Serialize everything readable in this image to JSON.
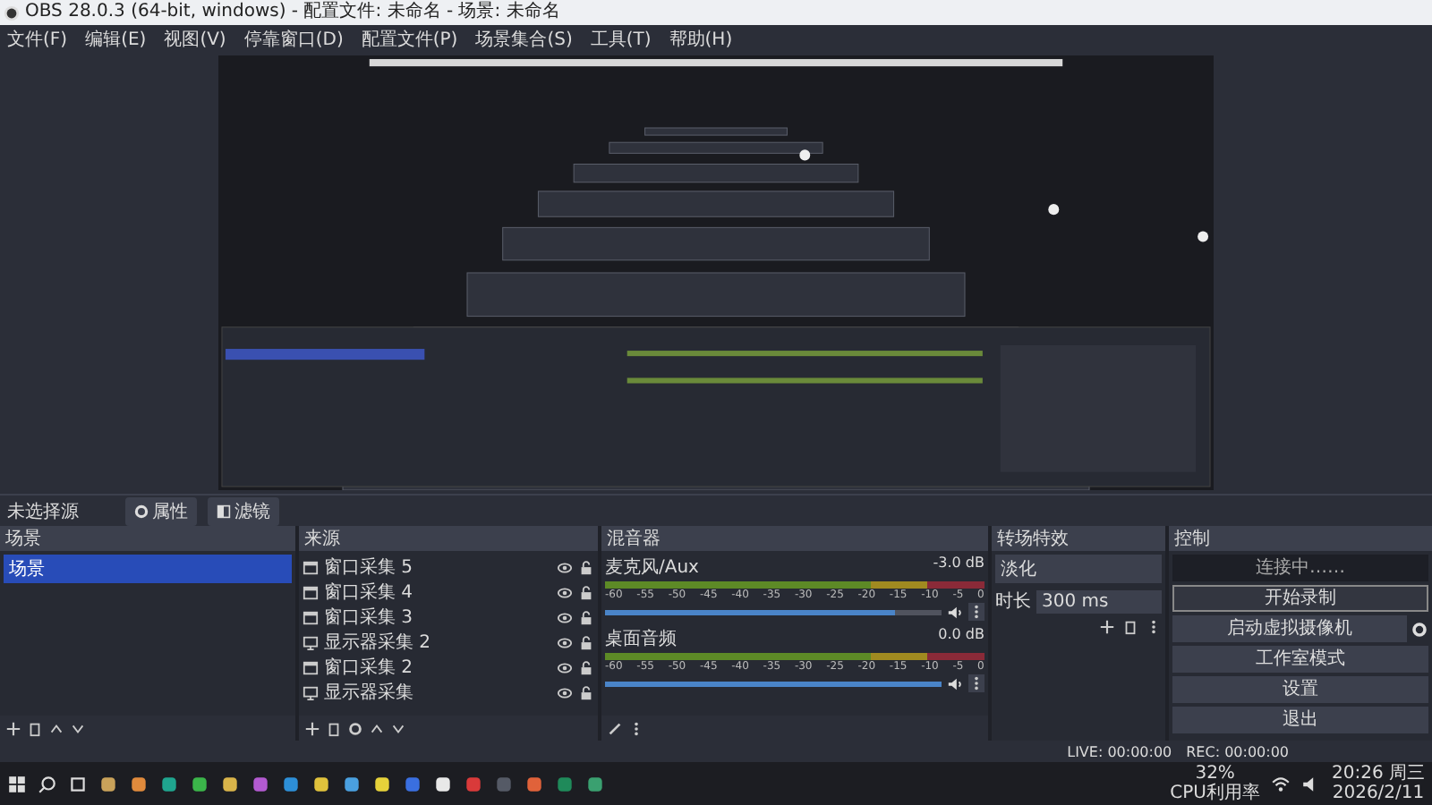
{
  "window": {
    "title": "OBS 28.0.3 (64-bit, windows) - 配置文件: 未命名 - 场景: 未命名"
  },
  "menu": [
    "文件(F)",
    "编辑(E)",
    "视图(V)",
    "停靠窗口(D)",
    "配置文件(P)",
    "场景集合(S)",
    "工具(T)",
    "帮助(H)"
  ],
  "source_bar": {
    "label": "未选择源",
    "buttons": [
      {
        "kind": "properties",
        "label": "属性"
      },
      {
        "kind": "filters",
        "label": "滤镜"
      }
    ]
  },
  "scenes": {
    "title": "场景",
    "items": [
      {
        "name": "场景",
        "selected": true
      }
    ]
  },
  "sources": {
    "title": "来源",
    "items": [
      {
        "name": "窗口采集 5",
        "kind": "window",
        "visible": true,
        "locked": false
      },
      {
        "name": "窗口采集 4",
        "kind": "window",
        "visible": true,
        "locked": false
      },
      {
        "name": "窗口采集 3",
        "kind": "window",
        "visible": true,
        "locked": false
      },
      {
        "name": "显示器采集 2",
        "kind": "monitor",
        "visible": true,
        "locked": false
      },
      {
        "name": "窗口采集 2",
        "kind": "window",
        "visible": true,
        "locked": false
      },
      {
        "name": "显示器采集",
        "kind": "monitor",
        "visible": true,
        "locked": false
      }
    ]
  },
  "mixer": {
    "title": "混音器",
    "channels": [
      {
        "name": "麦克风/Aux",
        "reading": "-3.0 dB",
        "ticks": [
          "-60",
          "-55",
          "-50",
          "-45",
          "-40",
          "-35",
          "-30",
          "-25",
          "-20",
          "-15",
          "-10",
          "-5",
          "0"
        ],
        "fader": {
          "level": 0.86
        }
      },
      {
        "name": "桌面音频",
        "reading": "0.0 dB",
        "ticks": [
          "-60",
          "-55",
          "-50",
          "-45",
          "-40",
          "-35",
          "-30",
          "-25",
          "-20",
          "-15",
          "-10",
          "-5",
          "0"
        ],
        "fader": {
          "level": 1.0
        }
      }
    ]
  },
  "transitions": {
    "title": "转场特效",
    "transition": "淡化",
    "duration_label": "时长",
    "duration": "300 ms"
  },
  "controls": {
    "title": "控制",
    "buttons": [
      {
        "label": "连接中……",
        "kind": "active"
      },
      {
        "label": "开始录制",
        "kind": "outlined"
      },
      {
        "label": "启动虚拟摄像机",
        "kind": "gear"
      },
      {
        "label": "工作室模式",
        "kind": "plain"
      },
      {
        "label": "设置",
        "kind": "plain"
      },
      {
        "label": "退出",
        "kind": "plain"
      }
    ]
  },
  "status_bar": {
    "live": "LIVE: 00:00:00",
    "rec": "REC: 00:00:00"
  },
  "taskbar": {
    "cpu_percent": "32%",
    "cpu_label": "CPU利用率",
    "time": "20:26 周三",
    "date": "2026/2/11"
  }
}
